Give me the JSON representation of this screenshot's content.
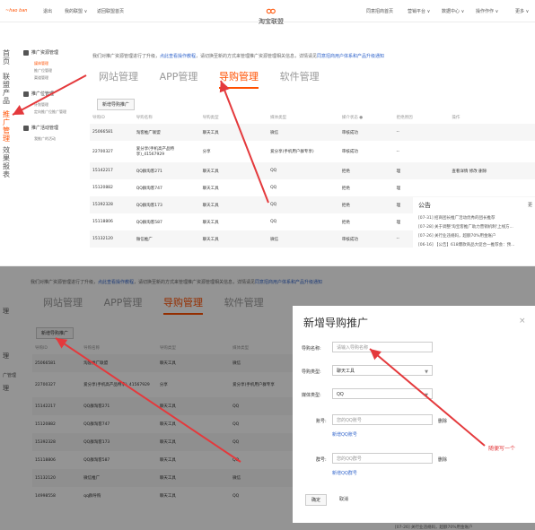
{
  "top": {
    "topbar": {
      "brand": "~hao ban",
      "logout": "退出",
      "my_union": "我的联盟 ∨",
      "back_home": "返回联盟首页",
      "logo_text": "淘宝联盟",
      "right_links": [
        "同意招商首页",
        "营销平台 ∨",
        "数据中心 ∨",
        "操作作作 ∨",
        "更多 ∨"
      ]
    },
    "side_nav": [
      "首页",
      "联盟产品",
      "推广管理",
      "效果报表"
    ],
    "menu": {
      "group1": "推广资源管理",
      "group1_items": [
        "媒体管理",
        "推广位管理",
        "渠道管理"
      ],
      "group2": "推广位管理",
      "group2_items": [
        "计划管理",
        "定向推广位推广管理"
      ],
      "group3": "推广活动管理",
      "group3_items": [
        "我推广的活动"
      ]
    },
    "notice": "我们对推广资源管理进行了升级，",
    "notice_link": "点此查看操作教程",
    "notice_more": "，请切换至新的方式来管理推广资源管理相关信息，详情请见",
    "notice_link2": "同意招商用户体系和产品升级通知",
    "tabs": [
      "网站管理",
      "APP管理",
      "导购管理",
      "软件管理"
    ],
    "active_tab": 2,
    "add_button": "新增导购推广",
    "columns": [
      "导购ID",
      "导购名称",
      "导购类型",
      "媒体类型",
      "媒介状态 ●",
      "拒绝原因",
      "操作"
    ],
    "rows": [
      {
        "id": "25066581",
        "name": "淘客推广联盟",
        "type": "聊天工具",
        "media": "微信",
        "status": "审核成功",
        "reason": "--",
        "ops": ""
      },
      {
        "id": "22700327",
        "name": "爱分享(手机高产品特享)_41567929",
        "type": "分享",
        "media": "爱分享(手机用户群专享)",
        "status": "审核成功",
        "reason": "--",
        "ops": ""
      },
      {
        "id": "15142217",
        "name": "QQ群淘客271",
        "type": "聊天工具",
        "media": "QQ",
        "status": "拒绝",
        "reason": "理",
        "ops": "查看详情  修改  删除"
      },
      {
        "id": "15120882",
        "name": "QQ群淘客747",
        "type": "聊天工具",
        "media": "QQ",
        "status": "拒绝",
        "reason": "理",
        "ops": ""
      },
      {
        "id": "15392328",
        "name": "QQ群淘客173",
        "type": "聊天工具",
        "media": "QQ",
        "status": "拒绝",
        "reason": "理",
        "ops": ""
      },
      {
        "id": "15118806",
        "name": "QQ群淘客587",
        "type": "聊天工具",
        "media": "QQ",
        "status": "拒绝",
        "reason": "理",
        "ops": ""
      },
      {
        "id": "15132120",
        "name": "微信推广",
        "type": "聊天工具",
        "media": "微信",
        "status": "审核成功",
        "reason": "--",
        "ops": ""
      }
    ],
    "announcement": {
      "title": "公告",
      "more": "更",
      "items": [
        "[07-31] 招商团长推广活动优秀的团长推荐",
        "[07-28] 关于调整'淘宝客推广助力营销机制'上线方...",
        "[07-26] 关行业违规码，超额70%用金账户",
        "[06-16] 【公告】618爆款商品大促合一推荐会：预..."
      ]
    }
  },
  "bottom": {
    "side_nav": [
      "理",
      "理",
      "广管理",
      "理"
    ],
    "notice": "我们对推广资源管理进行了升级，",
    "notice_link": "点此查看操作教程",
    "notice_more": "，请切换至新的方式来管理推广资源管理相关信息，详情请见",
    "notice_link2": "同意招商用户体系和产品升级通知",
    "tabs": [
      "网站管理",
      "APP管理",
      "导购管理",
      "软件管理"
    ],
    "active_tab": 2,
    "add_button": "新增导购推广",
    "columns": [
      "导购ID",
      "导购名称",
      "导购类型",
      "媒体类型"
    ],
    "rows": [
      {
        "id": "25066581",
        "name": "淘客推广联盟",
        "type": "聊天工具",
        "media": "微信"
      },
      {
        "id": "22700327",
        "name": "爱分享(手机高产品特享)_41567929",
        "type": "分享",
        "media": "爱分享(手机用户群专享"
      },
      {
        "id": "15142217",
        "name": "QQ群淘客271",
        "type": "聊天工具",
        "media": "QQ"
      },
      {
        "id": "15120882",
        "name": "QQ群淘客747",
        "type": "聊天工具",
        "media": "QQ"
      },
      {
        "id": "15392328",
        "name": "QQ群淘客173",
        "type": "聊天工具",
        "media": "QQ"
      },
      {
        "id": "15118806",
        "name": "QQ群淘客587",
        "type": "聊天工具",
        "media": "QQ"
      },
      {
        "id": "15132120",
        "name": "微信推广",
        "type": "聊天工具",
        "media": "微信"
      },
      {
        "id": "14998558",
        "name": "qq群导购",
        "type": "聊天工具",
        "media": "QQ"
      }
    ],
    "footer_fragment_1": "[07-31] ...",
    "footer_fragment_2": "[07-26] 关行业违规码，超额70%用金账户",
    "modal": {
      "title": "新增导购推广",
      "close": "×",
      "name_label": "导购名称:",
      "name_placeholder": "请输入导购名称",
      "type_label": "导购类型:",
      "type_value": "聊天工具",
      "media_label": "媒体类型:",
      "media_value": "QQ",
      "account_label": "账号:",
      "account_placeholder": "您的QQ账号",
      "delete1": "删除",
      "add_account": "新增QQ账号",
      "group_label": "群号:",
      "group_placeholder": "您的QQ群号",
      "delete2": "删除",
      "add_group": "新增QQ群号",
      "confirm": "确定",
      "cancel": "取消"
    },
    "annotation": "随便写一个"
  },
  "colors": {
    "accent": "#ff5000",
    "link": "#3366cc",
    "reject": "#e4393c",
    "success": "#2a9d2a",
    "arrow": "#e4393c"
  }
}
